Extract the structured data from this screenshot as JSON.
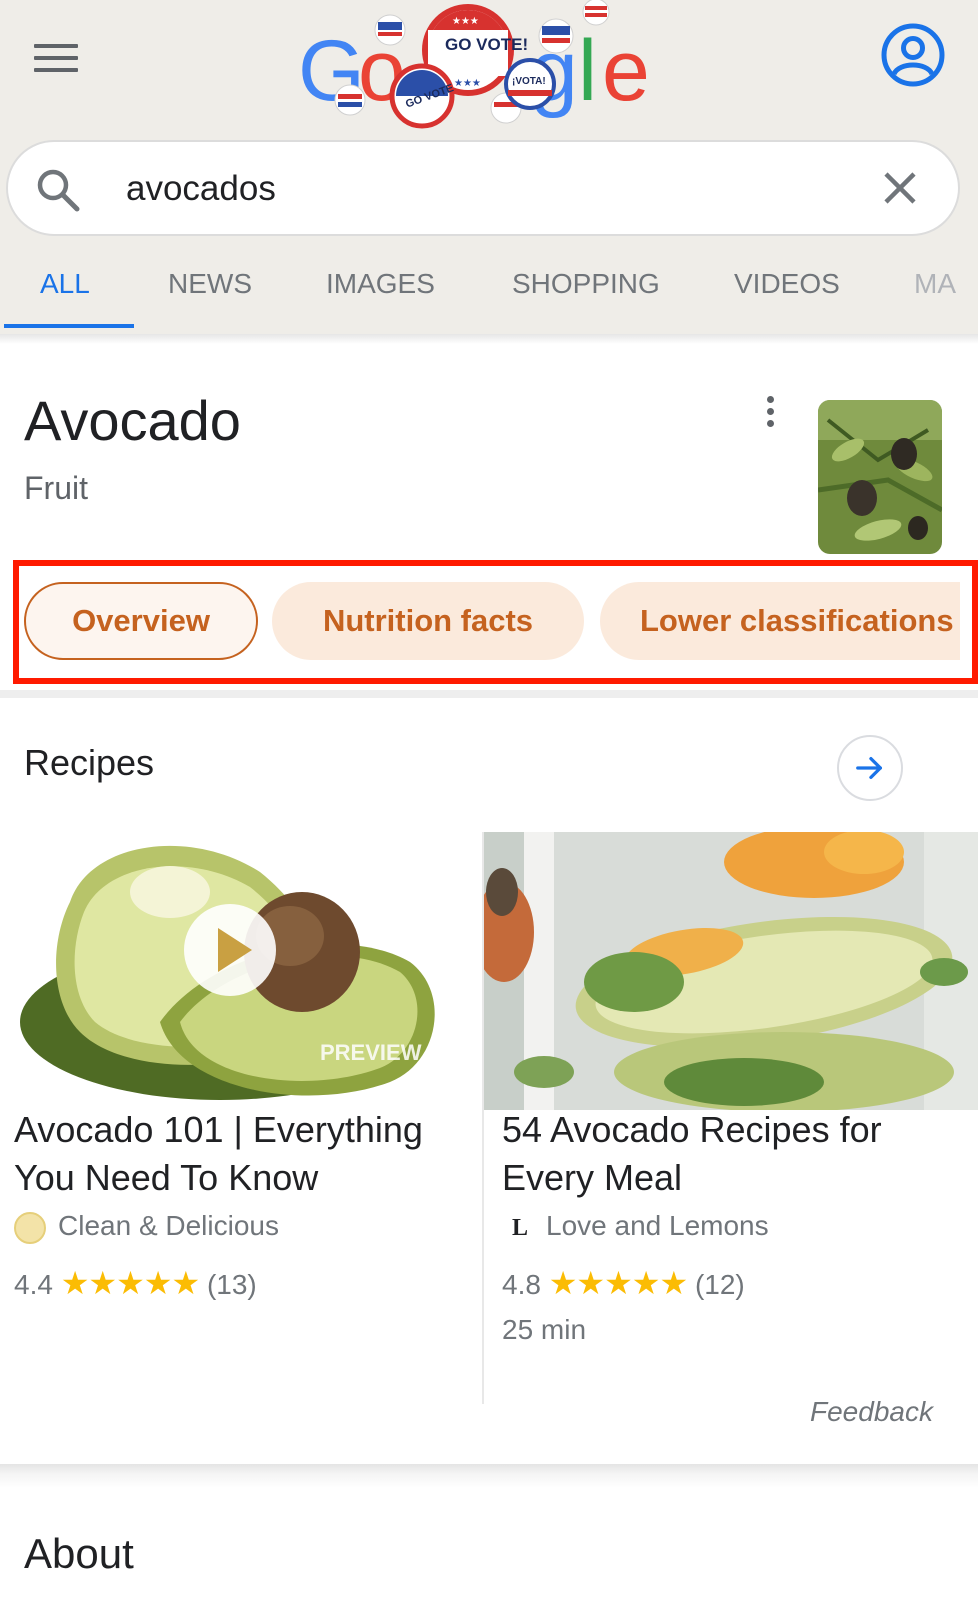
{
  "header": {
    "menu_icon": "hamburger-menu-icon",
    "logo_text": "Google",
    "logo_badges": [
      "GO VOTE!",
      "GO VOTE",
      "¡VOTA!"
    ],
    "account_icon": "account-circle-icon",
    "colors": {
      "background": "#efede8",
      "blue": "#4285f4",
      "red": "#ea4335",
      "yellow": "#fbbc05",
      "green": "#34a853"
    }
  },
  "search": {
    "value": "avocados",
    "search_icon": "search-icon",
    "clear_icon": "close-icon"
  },
  "tabs": [
    {
      "label": "ALL",
      "active": true
    },
    {
      "label": "NEWS"
    },
    {
      "label": "IMAGES"
    },
    {
      "label": "SHOPPING"
    },
    {
      "label": "VIDEOS"
    },
    {
      "label": "MA"
    }
  ],
  "entity": {
    "title": "Avocado",
    "subtitle": "Fruit",
    "more_icon": "more-vert-icon",
    "chips": [
      {
        "label": "Overview",
        "selected": true
      },
      {
        "label": "Nutrition facts"
      },
      {
        "label": "Lower classifications"
      }
    ],
    "chip_color": "#c5621f",
    "highlight_color": "#ff1a00"
  },
  "recipes": {
    "title": "Recipes",
    "arrow_icon": "arrow-forward-icon",
    "cards": [
      {
        "title": "Avocado 101 | Everything You Need To Know",
        "source": "Clean & Delicious",
        "rating": "4.4",
        "stars": "★★★★★",
        "reviews": "(13)",
        "preview_label": "PREVIEW",
        "play_icon": "play-icon"
      },
      {
        "title": "54 Avocado Recipes for Every Meal",
        "source": "Love and Lemons",
        "source_logo": "L",
        "rating": "4.8",
        "stars": "★★★★★",
        "reviews": "(12)",
        "time": "25 min"
      }
    ],
    "feedback": "Feedback"
  },
  "about": {
    "title": "About"
  }
}
